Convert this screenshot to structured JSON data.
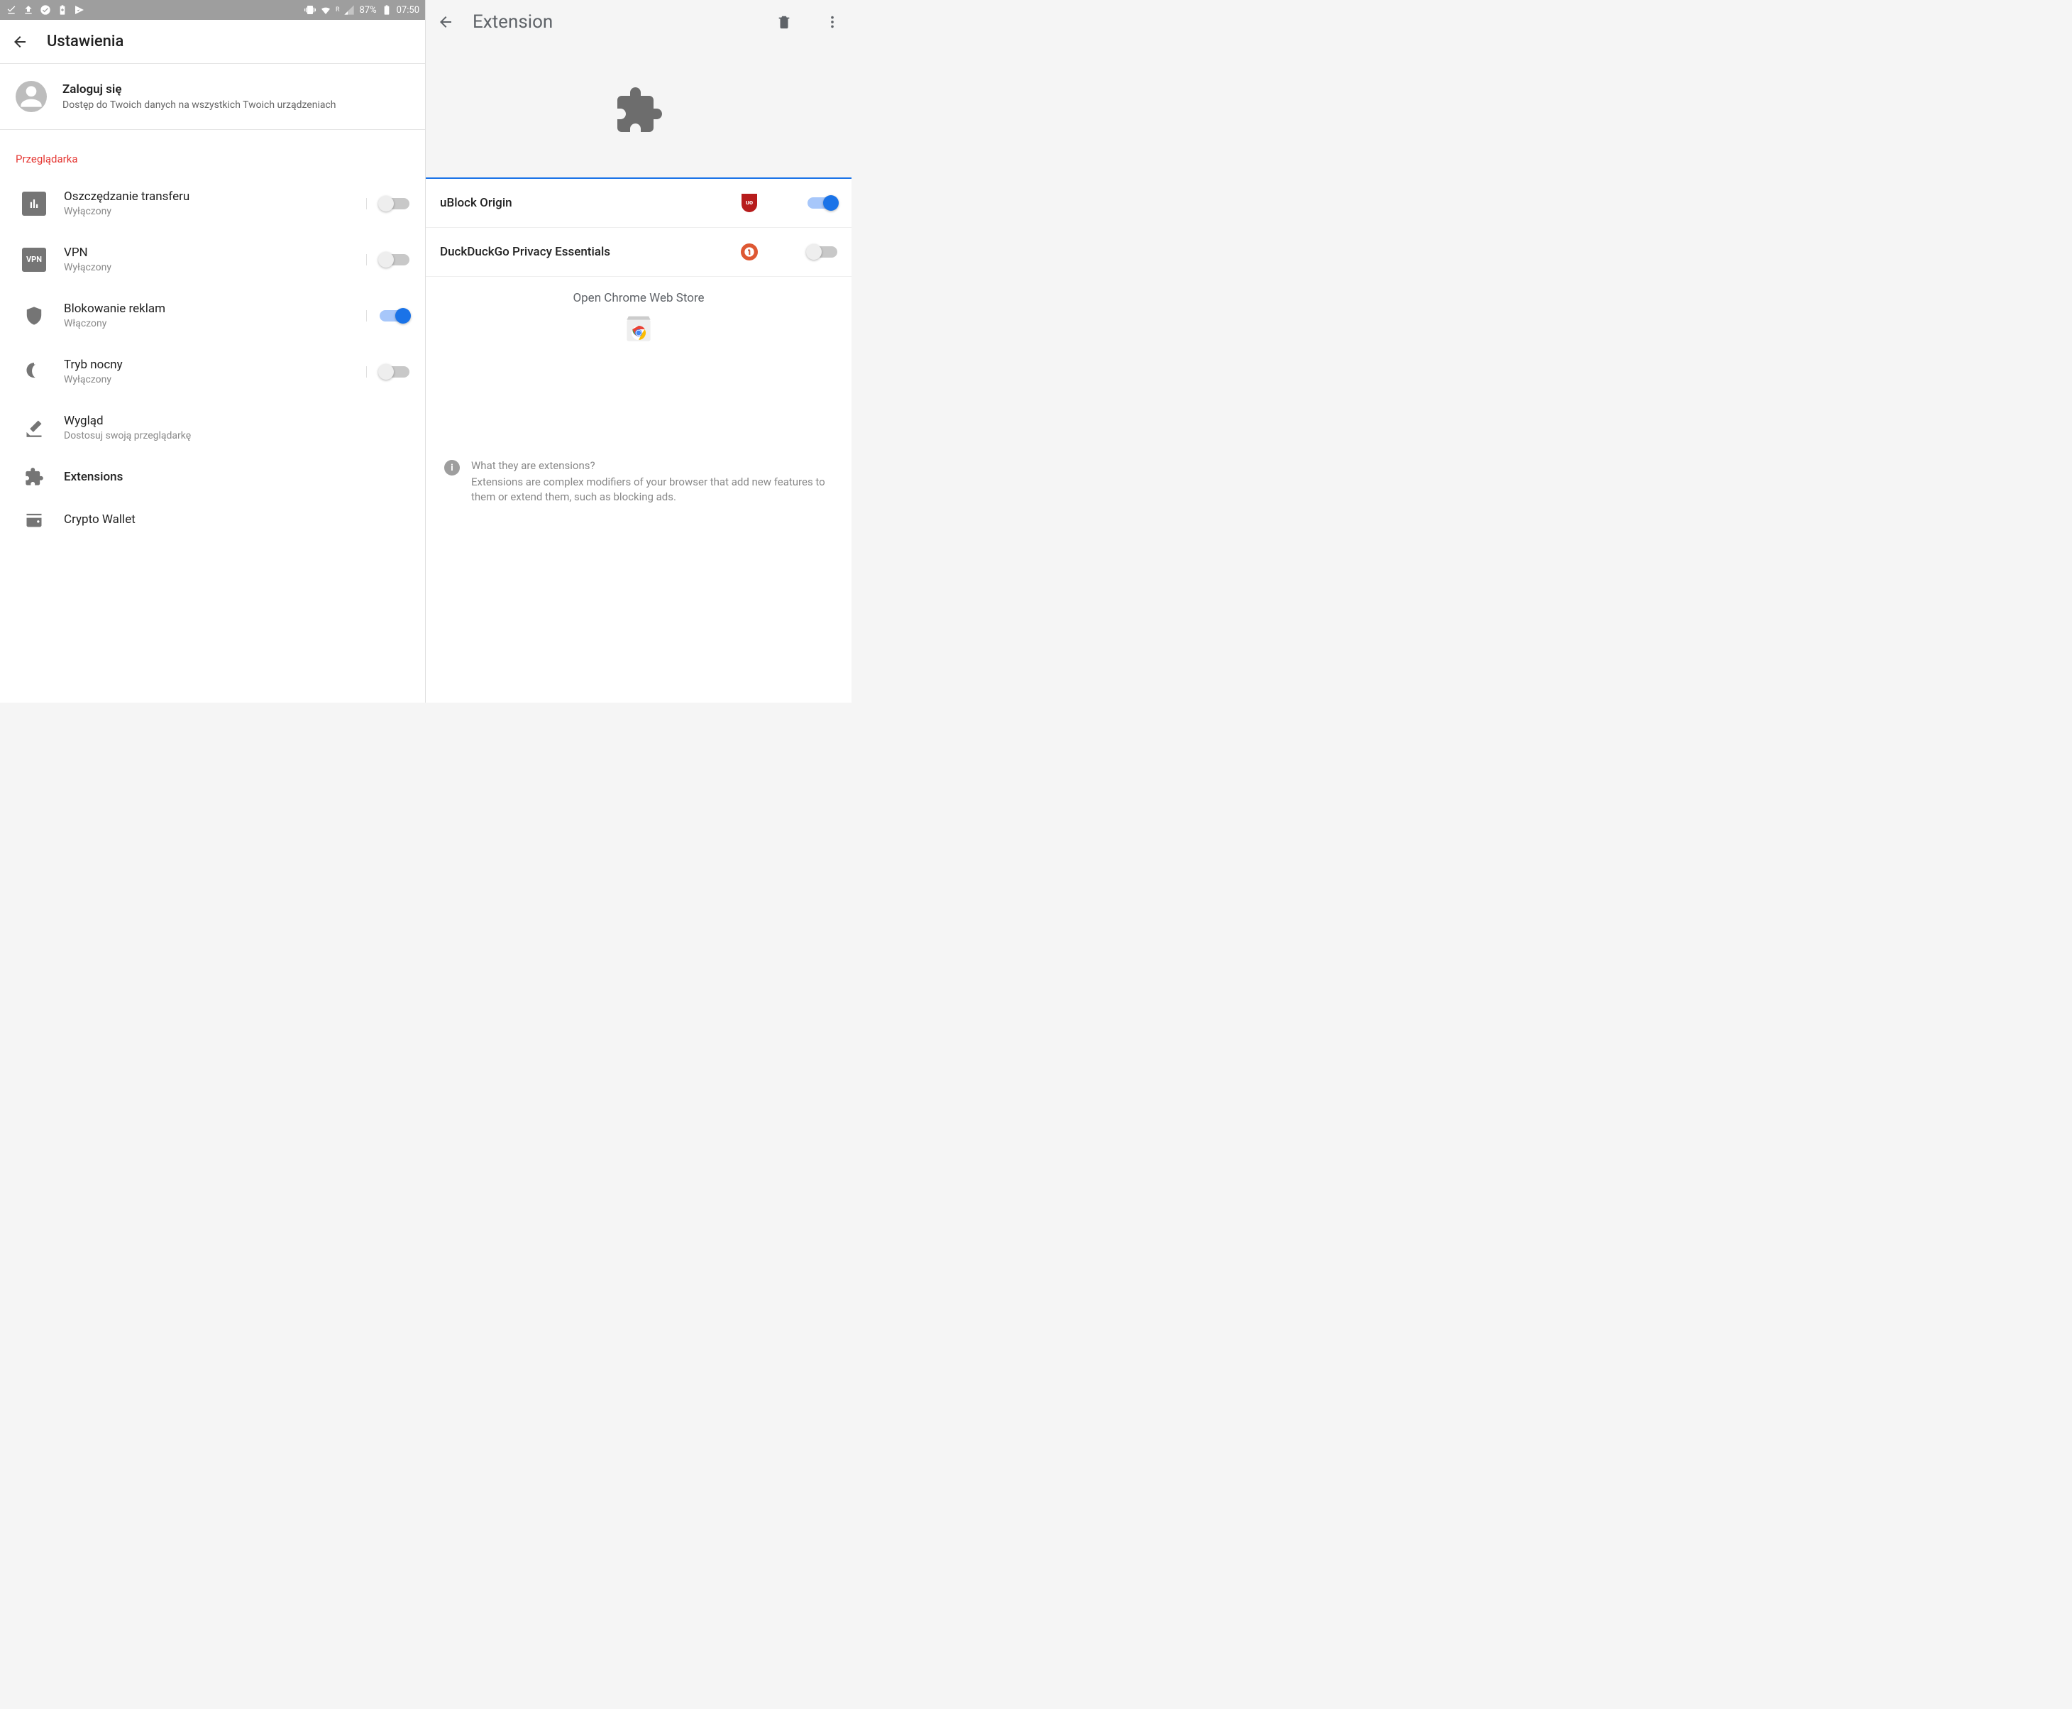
{
  "status": {
    "battery": "87%",
    "time": "07:50",
    "wifi_label": "R"
  },
  "left": {
    "app_title": "Ustawienia",
    "profile": {
      "title": "Zaloguj się",
      "subtitle": "Dostęp do Twoich danych na wszystkich Twoich urządzeniach"
    },
    "section": "Przeglądarka",
    "items": [
      {
        "title": "Oszczędzanie transferu",
        "sub": "Wyłączony",
        "toggle": "off"
      },
      {
        "title": "VPN",
        "sub": "Wyłączony",
        "toggle": "off"
      },
      {
        "title": "Blokowanie reklam",
        "sub": "Włączony",
        "toggle": "on"
      },
      {
        "title": "Tryb nocny",
        "sub": "Wyłączony",
        "toggle": "off"
      },
      {
        "title": "Wygląd",
        "sub": "Dostosuj swoją przeglądarkę"
      },
      {
        "title": "Extensions"
      },
      {
        "title": "Crypto Wallet"
      }
    ],
    "vpn_label": "VPN"
  },
  "right": {
    "app_title": "Extension",
    "extensions": [
      {
        "name": "uBlock Origin",
        "badge": "uo",
        "toggle": "on"
      },
      {
        "name": "DuckDuckGo Privacy Essentials",
        "toggle": "off"
      }
    ],
    "webstore": "Open Chrome Web Store",
    "info_title": "What they are extensions?",
    "info_body": "Extensions are complex modifiers of your browser that add new features to them or extend them, such as blocking ads."
  }
}
